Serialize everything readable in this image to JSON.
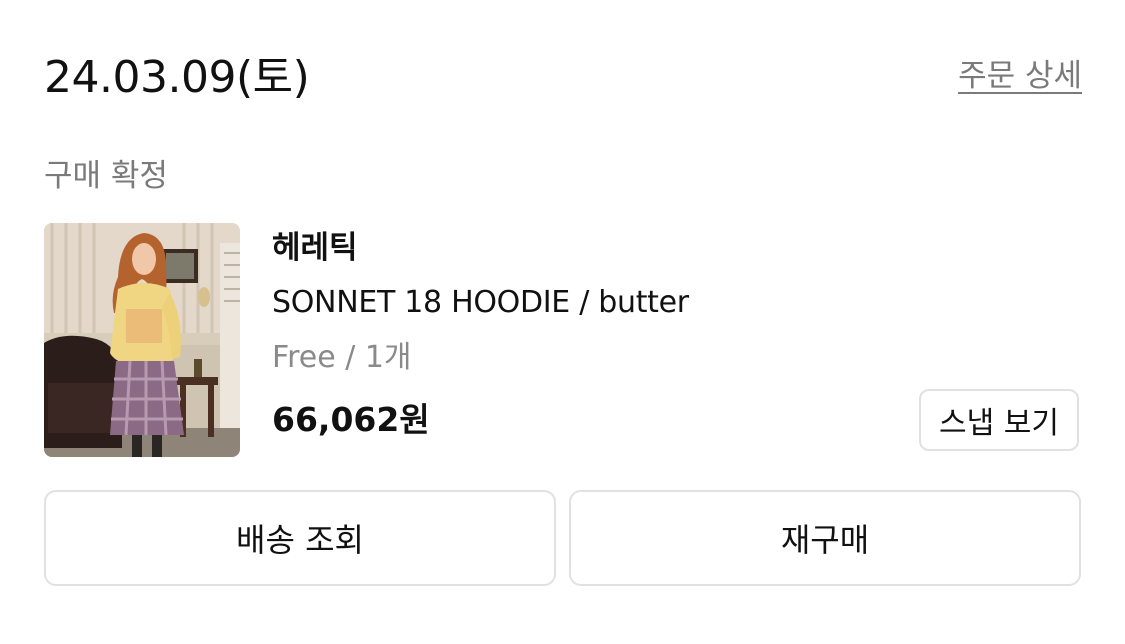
{
  "order": {
    "date": "24.03.09(토)",
    "detail_link_label": "주문 상세",
    "status": "구매 확정"
  },
  "product": {
    "brand": "헤레틱",
    "name": "SONNET 18 HOODIE / butter",
    "option": "Free / 1개",
    "price": "66,062원",
    "snap_button_label": "스냅 보기"
  },
  "actions": {
    "tracking_label": "배송 조회",
    "reorder_label": "재구매"
  },
  "colors": {
    "text_primary": "#111111",
    "text_secondary": "#7a7a7a",
    "border": "#e1e1e1",
    "background": "#ffffff"
  }
}
